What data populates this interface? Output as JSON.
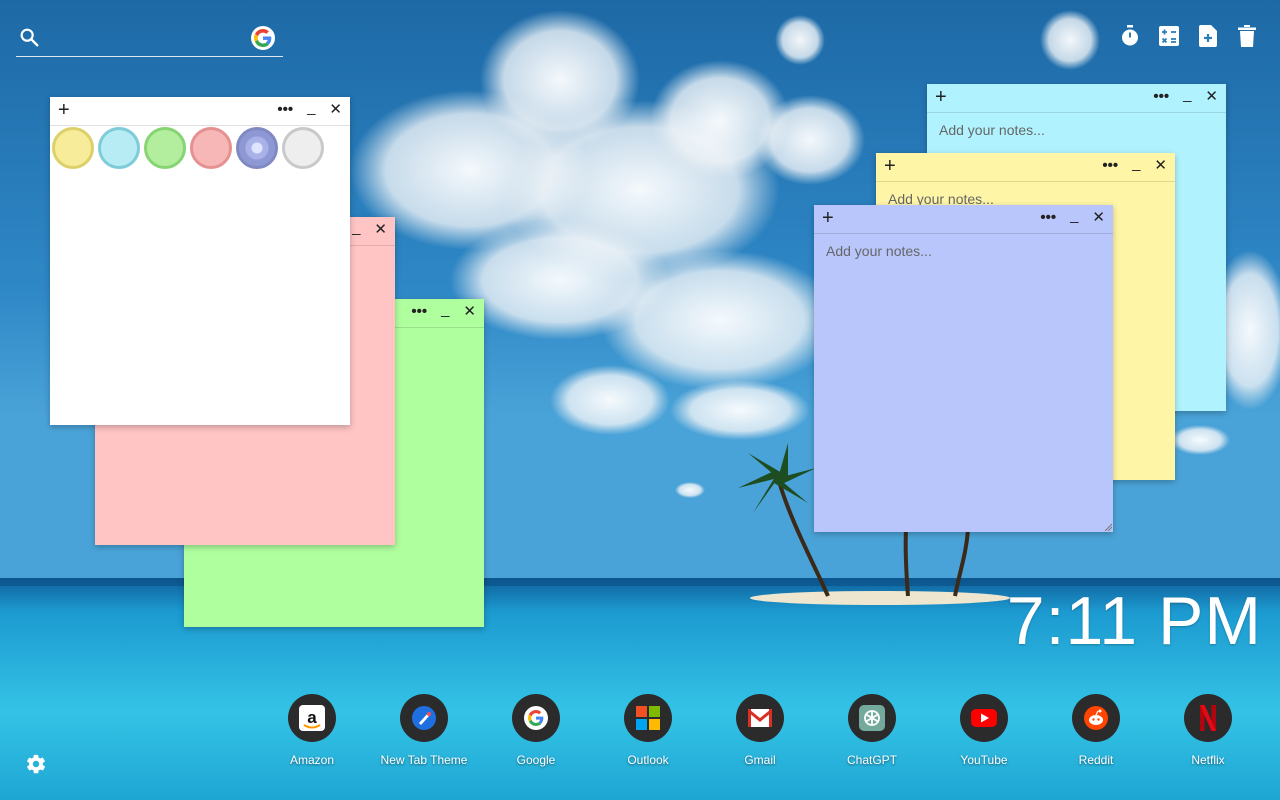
{
  "search": {
    "placeholder": ""
  },
  "tools": [
    {
      "name": "timer-icon"
    },
    {
      "name": "calculator-icon"
    },
    {
      "name": "new-note-icon"
    },
    {
      "name": "trash-icon"
    }
  ],
  "notes": {
    "white": {
      "color": "#ffffff",
      "swatches": [
        "#f7ec9a",
        "#b7ecf5",
        "#b3ee9f",
        "#f7b7b7",
        "#a9b2e8",
        "#eeeeee"
      ]
    },
    "pink": {
      "color": "#ffc4c4"
    },
    "green": {
      "color": "#b0ff9f"
    },
    "cyan": {
      "color": "#b0f3ff",
      "placeholder": "Add your notes..."
    },
    "yellow": {
      "color": "#fff5a6",
      "placeholder": "Add your notes..."
    },
    "blue": {
      "color": "#b8c6fb",
      "placeholder": "Add your notes..."
    }
  },
  "controls": {
    "add": "+",
    "more": "•••",
    "minimize": "_",
    "close": "✕"
  },
  "clock": {
    "time": "7:11 PM"
  },
  "shortcuts": [
    {
      "label": "Amazon",
      "icon": "amazon-icon"
    },
    {
      "label": "New Tab Theme",
      "icon": "new-tab-theme-icon"
    },
    {
      "label": "Google",
      "icon": "google-icon"
    },
    {
      "label": "Outlook",
      "icon": "outlook-icon"
    },
    {
      "label": "Gmail",
      "icon": "gmail-icon"
    },
    {
      "label": "ChatGPT",
      "icon": "chatgpt-icon"
    },
    {
      "label": "YouTube",
      "icon": "youtube-icon"
    },
    {
      "label": "Reddit",
      "icon": "reddit-icon"
    },
    {
      "label": "Netflix",
      "icon": "netflix-icon"
    }
  ]
}
